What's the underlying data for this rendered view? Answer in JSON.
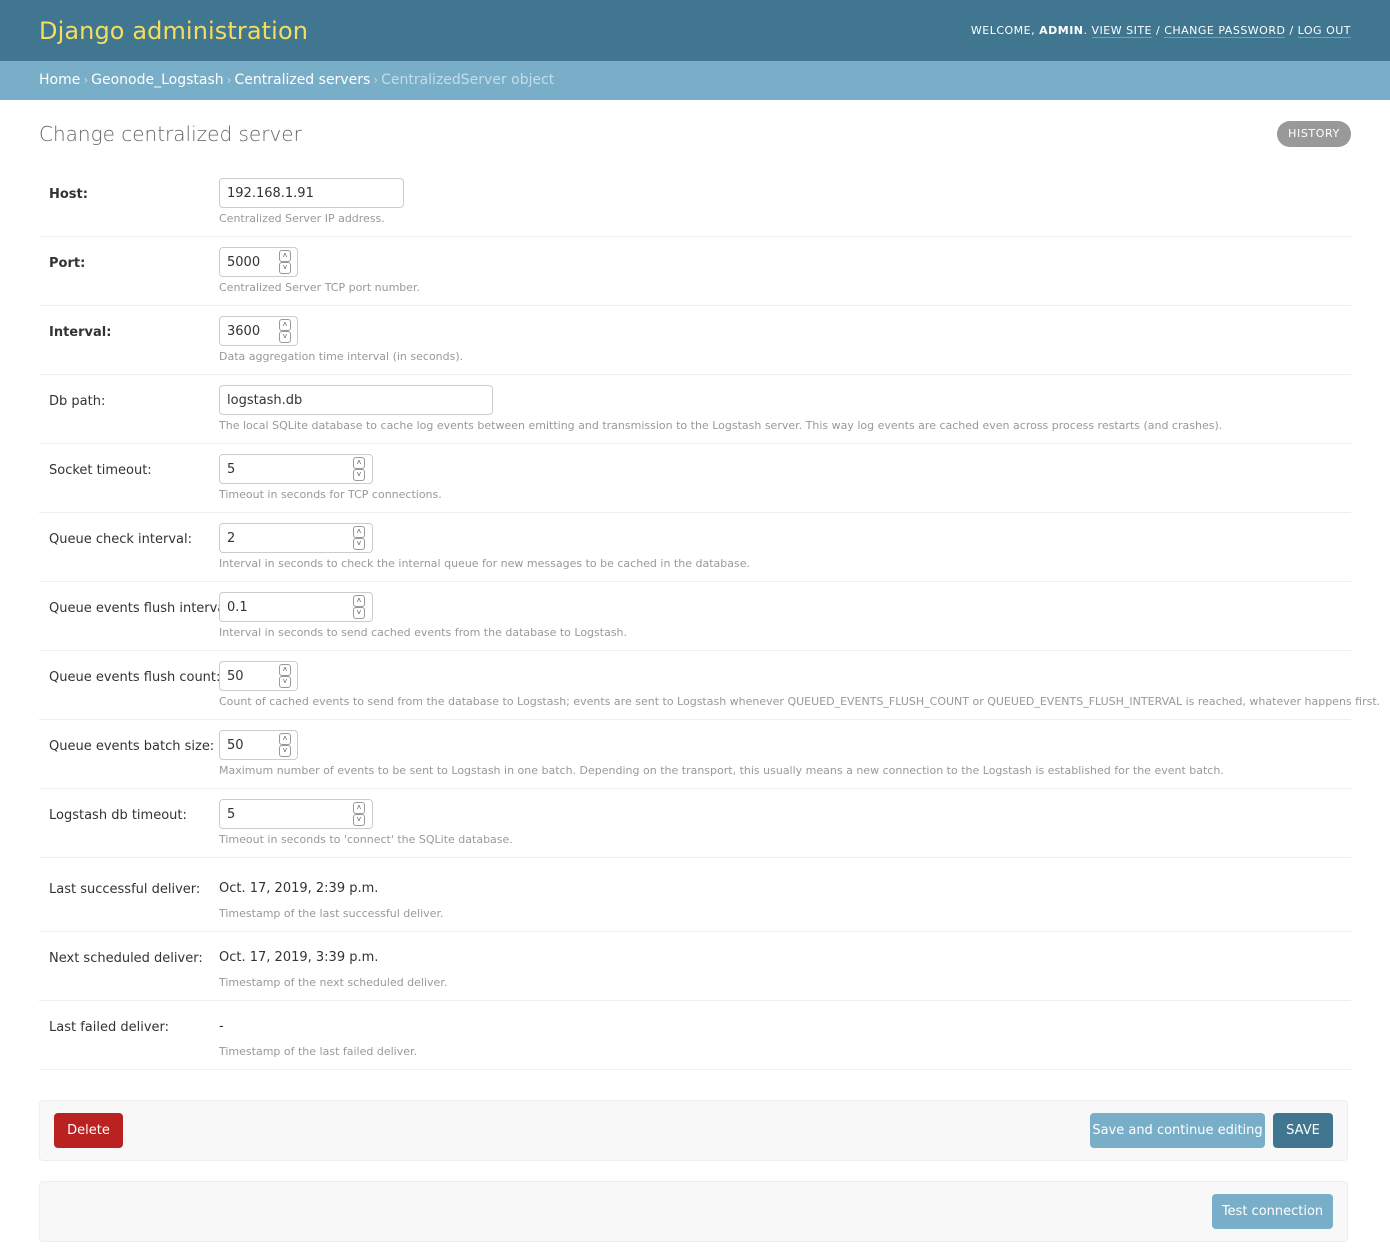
{
  "header": {
    "branding": "Django administration",
    "welcome": "Welcome,",
    "username": "admin",
    "links": {
      "view_site": "View site",
      "change_password": "Change password",
      "log_out": "Log out"
    }
  },
  "breadcrumbs": {
    "home": "Home",
    "app": "Geonode_Logstash",
    "model": "Centralized servers",
    "current": "CentralizedServer object"
  },
  "page": {
    "title": "Change centralized server",
    "history": "History"
  },
  "fields": {
    "host": {
      "label": "Host:",
      "value": "192.168.1.91",
      "help": "Centralized Server IP address."
    },
    "port": {
      "label": "Port:",
      "value": "5000",
      "help": "Centralized Server TCP port number."
    },
    "interval": {
      "label": "Interval:",
      "value": "3600",
      "help": "Data aggregation time interval (in seconds)."
    },
    "db_path": {
      "label": "Db path:",
      "value": "logstash.db",
      "help": "The local SQLite database to cache log events between emitting and transmission to the Logstash server. This way log events are cached even across process restarts (and crashes)."
    },
    "socket_timeout": {
      "label": "Socket timeout:",
      "value": "5",
      "help": "Timeout in seconds for TCP connections."
    },
    "queue_check_interval": {
      "label": "Queue check interval:",
      "value": "2",
      "help": "Interval in seconds to check the internal queue for new messages to be cached in the database."
    },
    "queue_events_flush_interval": {
      "label": "Queue events flush interval:",
      "value": "0.1",
      "help": "Interval in seconds to send cached events from the database to Logstash."
    },
    "queue_events_flush_count": {
      "label": "Queue events flush count:",
      "value": "50",
      "help": "Count of cached events to send from the database to Logstash; events are sent to Logstash whenever QUEUED_EVENTS_FLUSH_COUNT or QUEUED_EVENTS_FLUSH_INTERVAL is reached, whatever happens first."
    },
    "queue_events_batch_size": {
      "label": "Queue events batch size:",
      "value": "50",
      "help": "Maximum number of events to be sent to Logstash in one batch. Depending on the transport, this usually means a new connection to the Logstash is established for the event batch."
    },
    "logstash_db_timeout": {
      "label": "Logstash db timeout:",
      "value": "5",
      "help": "Timeout in seconds to 'connect' the SQLite database."
    },
    "last_successful_deliver": {
      "label": "Last successful deliver:",
      "value": "Oct. 17, 2019, 2:39 p.m.",
      "help": "Timestamp of the last successful deliver."
    },
    "next_scheduled_deliver": {
      "label": "Next scheduled deliver:",
      "value": "Oct. 17, 2019, 3:39 p.m.",
      "help": "Timestamp of the next scheduled deliver."
    },
    "last_failed_deliver": {
      "label": "Last failed deliver:",
      "value": "-",
      "help": "Timestamp of the last failed deliver."
    }
  },
  "actions": {
    "delete": "Delete",
    "save_continue": "Save and continue editing",
    "save": "Save",
    "test_connection": "Test connection"
  },
  "colors": {
    "header": "#417690",
    "breadcrumbs": "#79aec8",
    "branding": "#f5dd5d",
    "delete": "#ba2121"
  }
}
